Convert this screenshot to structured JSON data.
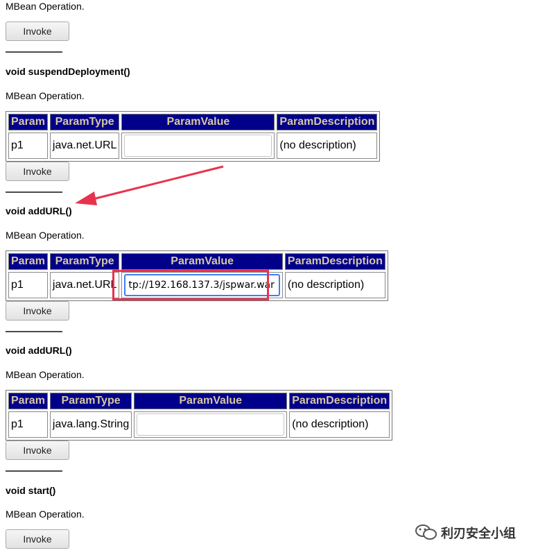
{
  "common": {
    "mbean_operation": "MBean Operation.",
    "invoke_label": "Invoke"
  },
  "table_headers": [
    "Param",
    "ParamType",
    "ParamValue",
    "ParamDescription"
  ],
  "operations": [
    {
      "signature": "void suspendDeployment()",
      "param": "p1",
      "param_type": "java.net.URL",
      "param_value": "",
      "param_desc": "(no description)"
    },
    {
      "signature": "void addURL()",
      "param": "p1",
      "param_type": "java.net.URL",
      "param_value": "tp://192.168.137.3/jspwar.war",
      "param_desc": "(no description)"
    },
    {
      "signature": "void addURL()",
      "param": "p1",
      "param_type": "java.lang.String",
      "param_value": "",
      "param_desc": "(no description)"
    },
    {
      "signature": "void start()"
    }
  ],
  "watermark": "利刃安全小组",
  "colors": {
    "header_bg": "#00008b",
    "header_text": "#d8c8a0",
    "annotation": "#e8334d",
    "focus": "#3d7ff2"
  }
}
